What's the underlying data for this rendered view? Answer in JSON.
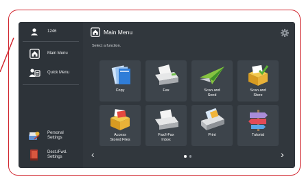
{
  "sidebar": {
    "user": {
      "label": "1246",
      "icon": "user-icon"
    },
    "items": [
      {
        "label": "Main Menu",
        "icon": "home-icon"
      },
      {
        "label": "Quick Menu",
        "icon": "quick-menu-icon"
      }
    ],
    "bottom_items": [
      {
        "label_line1": "Personal",
        "label_line2": "Settings",
        "icon": "personal-settings-icon"
      },
      {
        "label_line1": "Dest./Fwd.",
        "label_line2": "Settings",
        "icon": "destination-settings-icon"
      }
    ]
  },
  "header": {
    "title": "Main Menu",
    "icon": "home-icon",
    "settings_icon": "gear-icon"
  },
  "prompt": "Select a function.",
  "tiles": [
    {
      "line1": "Copy",
      "line2": "",
      "icon": "copy-icon"
    },
    {
      "line1": "Fax",
      "line2": "",
      "icon": "fax-icon"
    },
    {
      "line1": "Scan and",
      "line2": "Send",
      "icon": "scan-send-icon"
    },
    {
      "line1": "Scan and",
      "line2": "Store",
      "icon": "scan-store-icon"
    },
    {
      "line1": "Access",
      "line2": "Stored Files",
      "icon": "access-stored-files-icon"
    },
    {
      "line1": "Fax/I-Fax",
      "line2": "Inbox",
      "icon": "fax-inbox-icon"
    },
    {
      "line1": "Print",
      "line2": "",
      "icon": "print-icon"
    },
    {
      "line1": "Tutorial",
      "line2": "",
      "icon": "tutorial-icon"
    }
  ],
  "pager": {
    "pages": 2,
    "current": 1
  },
  "nav": {
    "prev": "‹",
    "next": "›"
  },
  "colors": {
    "frame": "#d1262f",
    "screen_bg": "#31373d",
    "sidebar_bg": "#2d3339",
    "tile_bg": "#3d444b"
  }
}
